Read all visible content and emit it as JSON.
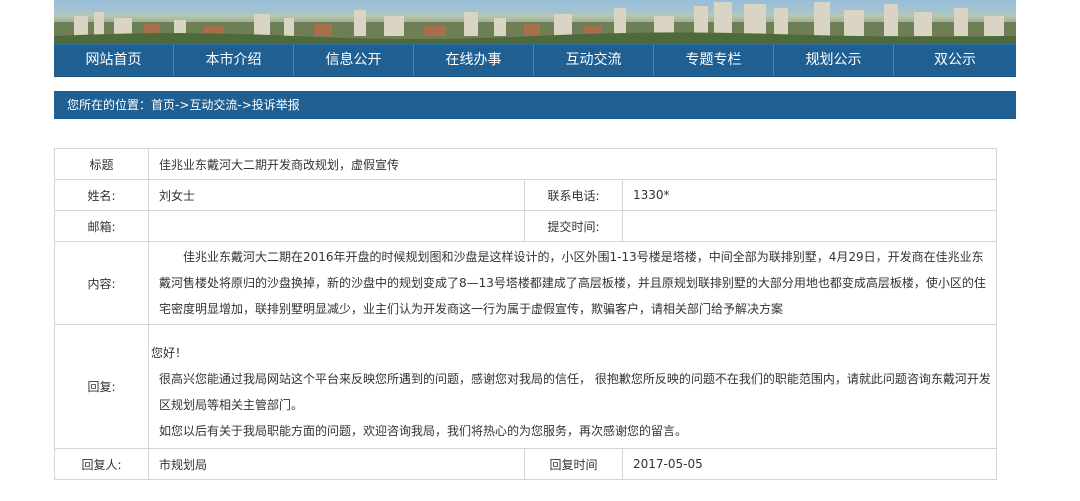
{
  "nav": {
    "items": [
      "网站首页",
      "本市介绍",
      "信息公开",
      "在线办事",
      "互动交流",
      "专题专栏",
      "规划公示",
      "双公示"
    ]
  },
  "breadcrumb": {
    "text": "您所在的位置：首页->互动交流->投诉举报"
  },
  "record": {
    "title_label": "标题",
    "title_value": "佳兆业东戴河大二期开发商改规划，虚假宣传",
    "name_label": "姓名:",
    "name_value": "刘女士",
    "phone_label": "联系电话:",
    "phone_value": "1330*",
    "email_label": "邮箱:",
    "email_value": "",
    "submit_time_label": "提交时间:",
    "submit_time_value": "",
    "content_label": "内容:",
    "content_value": "佳兆业东戴河大二期在2016年开盘的时候规划图和沙盘是这样设计的，小区外围1-13号楼是塔楼，中间全部为联排别墅，4月29日，开发商在佳兆业东戴河售楼处将原归的沙盘换掉，新的沙盘中的规划变成了8—13号塔楼都建成了高层板楼，并且原规划联排别墅的大部分用地也都变成高层板楼，使小区的住宅密度明显增加，联排别墅明显减少，业主们认为开发商这一行为属于虚假宣传，欺骗客户，请相关部门给予解决方案",
    "reply_label": "回复:",
    "reply_greeting": "您好！",
    "reply_line1": "很高兴您能通过我局网站这个平台来反映您所遇到的问题，感谢您对我局的信任， 很抱歉您所反映的问题不在我们的职能范围内，请就此问题咨询东戴河开发区规划局等相关主管部门。",
    "reply_line2": "如您以后有关于我局职能方面的问题，欢迎咨询我局，我们将热心的为您服务，再次感谢您的留言。",
    "replier_label": "回复人:",
    "replier_value": "市规划局",
    "reply_time_label": "回复时间",
    "reply_time_value": "2017-05-05"
  },
  "colors": {
    "nav_background": "#1f5f92",
    "table_border": "#d6d6d6",
    "text": "#333333"
  }
}
